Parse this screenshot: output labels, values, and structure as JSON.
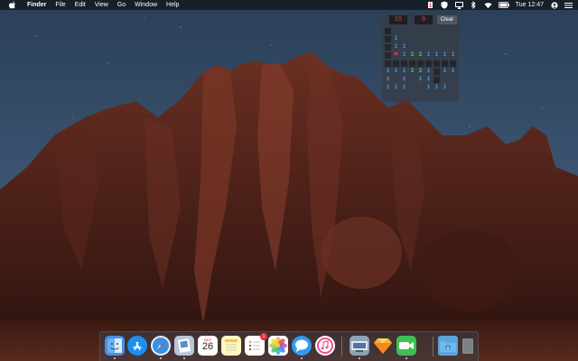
{
  "menubar": {
    "app_name": "Finder",
    "menus": [
      "File",
      "Edit",
      "View",
      "Go",
      "Window",
      "Help"
    ],
    "status_icons": [
      "mines-status-icon",
      "vpn-shield-icon",
      "airplay-icon",
      "bluetooth-icon",
      "wifi-icon",
      "battery-icon"
    ],
    "clock": "Tue 12:47"
  },
  "minesweeper": {
    "mine_counter": "15",
    "timer": "9",
    "clear_label": "Clear",
    "grid": [
      [
        "#",
        " ",
        " ",
        " ",
        " ",
        " ",
        " ",
        " ",
        " "
      ],
      [
        "#",
        "1",
        " ",
        " ",
        " ",
        " ",
        " ",
        " ",
        " "
      ],
      [
        "#",
        "1",
        "1",
        " ",
        " ",
        " ",
        " ",
        " ",
        " "
      ],
      [
        "#",
        "F",
        "1",
        "2",
        "2",
        "1",
        "1",
        "1",
        "1"
      ],
      [
        "#",
        "#",
        "#",
        "#",
        "#",
        "#",
        "#",
        "#",
        "#"
      ],
      [
        "1",
        "1",
        "1",
        "2",
        "2",
        "1",
        "#",
        "1",
        "1"
      ],
      [
        "1",
        " ",
        "1",
        " ",
        "1",
        "1",
        "#",
        " ",
        " "
      ],
      [
        "1",
        "1",
        "1",
        " ",
        " ",
        "1",
        "1",
        "1",
        " "
      ],
      [
        " ",
        " ",
        " ",
        " ",
        " ",
        " ",
        " ",
        " ",
        " "
      ]
    ],
    "colors": {
      "lcd": "#e04545",
      "one": "#3aa0ff",
      "two": "#3cd65a",
      "flag": "#ff3030"
    }
  },
  "dock": {
    "calendar": {
      "month": "OCT",
      "day": "26"
    },
    "reminders_badge": "1",
    "apps": [
      "finder-icon",
      "app-store-icon",
      "safari-icon",
      "preview-icon",
      "calendar-icon",
      "notes-icon",
      "reminders-icon",
      "photos-icon",
      "messages-icon",
      "itunes-icon",
      "image-capture-icon",
      "sketch-icon",
      "facetime-icon",
      "downloads-folder-icon",
      "trash-icon"
    ]
  }
}
